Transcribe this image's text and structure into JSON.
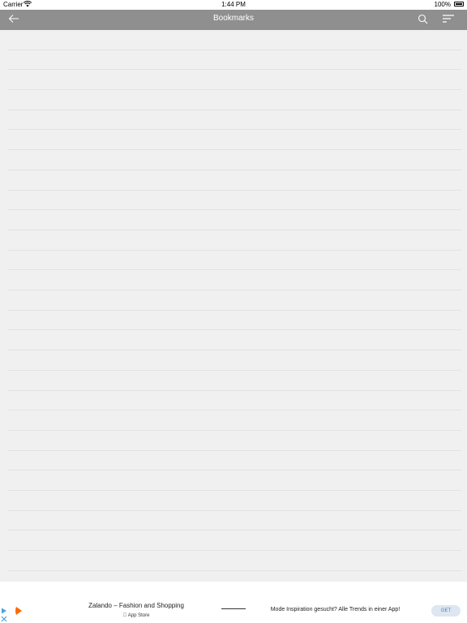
{
  "status_bar": {
    "carrier": "Carrier",
    "time": "1:44 PM",
    "battery": "100%"
  },
  "nav": {
    "title": "Bookmarks",
    "back_icon": "arrow-left-icon",
    "search_icon": "search-icon",
    "sort_icon": "sort-icon"
  },
  "list": {
    "row_count": 27
  },
  "ad": {
    "app_name": "Zalando – Fashion and Shopping",
    "store": "App Store",
    "promo": "Mode Inspiration gesucht? Alle Trends in einer App!",
    "cta": "GET",
    "accent_color": "#ff6900"
  }
}
